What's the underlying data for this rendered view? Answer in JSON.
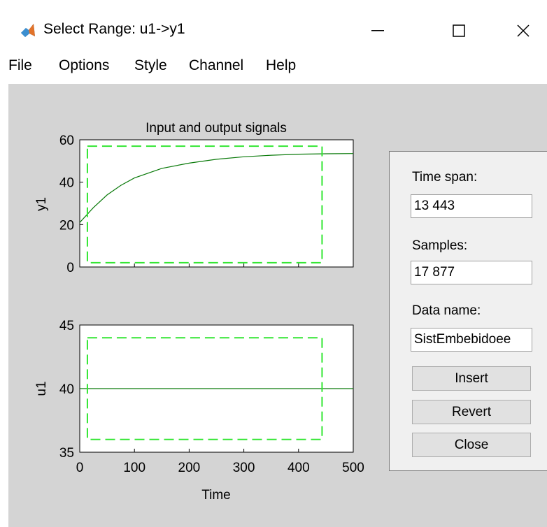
{
  "window": {
    "title": "Select Range: u1->y1",
    "controls": {
      "minimize": "—",
      "maximize": "☐",
      "close": "✕"
    }
  },
  "menu": [
    "File",
    "Options",
    "Style",
    "Channel",
    "Help"
  ],
  "colors": {
    "client_bg": "#d4d4d4",
    "signal": "#0a7a0a",
    "selection": "#33e633"
  },
  "plots": {
    "title": "Input and output signals",
    "xlabel": "Time",
    "top": {
      "ylabel": "y1",
      "yticks": [
        "0",
        "20",
        "40",
        "60"
      ]
    },
    "bottom": {
      "ylabel": "u1",
      "yticks": [
        "35",
        "40",
        "45"
      ]
    },
    "xticks": [
      "0",
      "100",
      "200",
      "300",
      "400",
      "500"
    ]
  },
  "chart_data": [
    {
      "type": "line",
      "title": "Input and output signals",
      "ylabel": "y1",
      "xlim": [
        0,
        500
      ],
      "ylim": [
        0,
        60
      ],
      "series": [
        {
          "x": [
            0,
            25,
            50,
            75,
            100,
            150,
            200,
            250,
            300,
            350,
            400,
            450,
            500
          ],
          "y": [
            21,
            28,
            34,
            38.5,
            42,
            46.5,
            49,
            50.8,
            52,
            52.7,
            53.2,
            53.4,
            53.5
          ]
        }
      ],
      "selection": {
        "x": [
          14,
          443
        ],
        "y": [
          2,
          57
        ]
      }
    },
    {
      "type": "line",
      "xlabel": "Time",
      "ylabel": "u1",
      "xlim": [
        0,
        500
      ],
      "ylim": [
        35,
        45
      ],
      "series": [
        {
          "x": [
            0,
            500
          ],
          "y": [
            40,
            40
          ]
        }
      ],
      "selection": {
        "x": [
          14,
          443
        ],
        "y": [
          36,
          44
        ]
      }
    }
  ],
  "panel": {
    "time_span_label": "Time span:",
    "time_span_value": "13 443",
    "samples_label": "Samples:",
    "samples_value": "17 877",
    "data_name_label": "Data name:",
    "data_name_value": "SistEmbebidoee",
    "insert_label": "Insert",
    "revert_label": "Revert",
    "close_label": "Close"
  }
}
